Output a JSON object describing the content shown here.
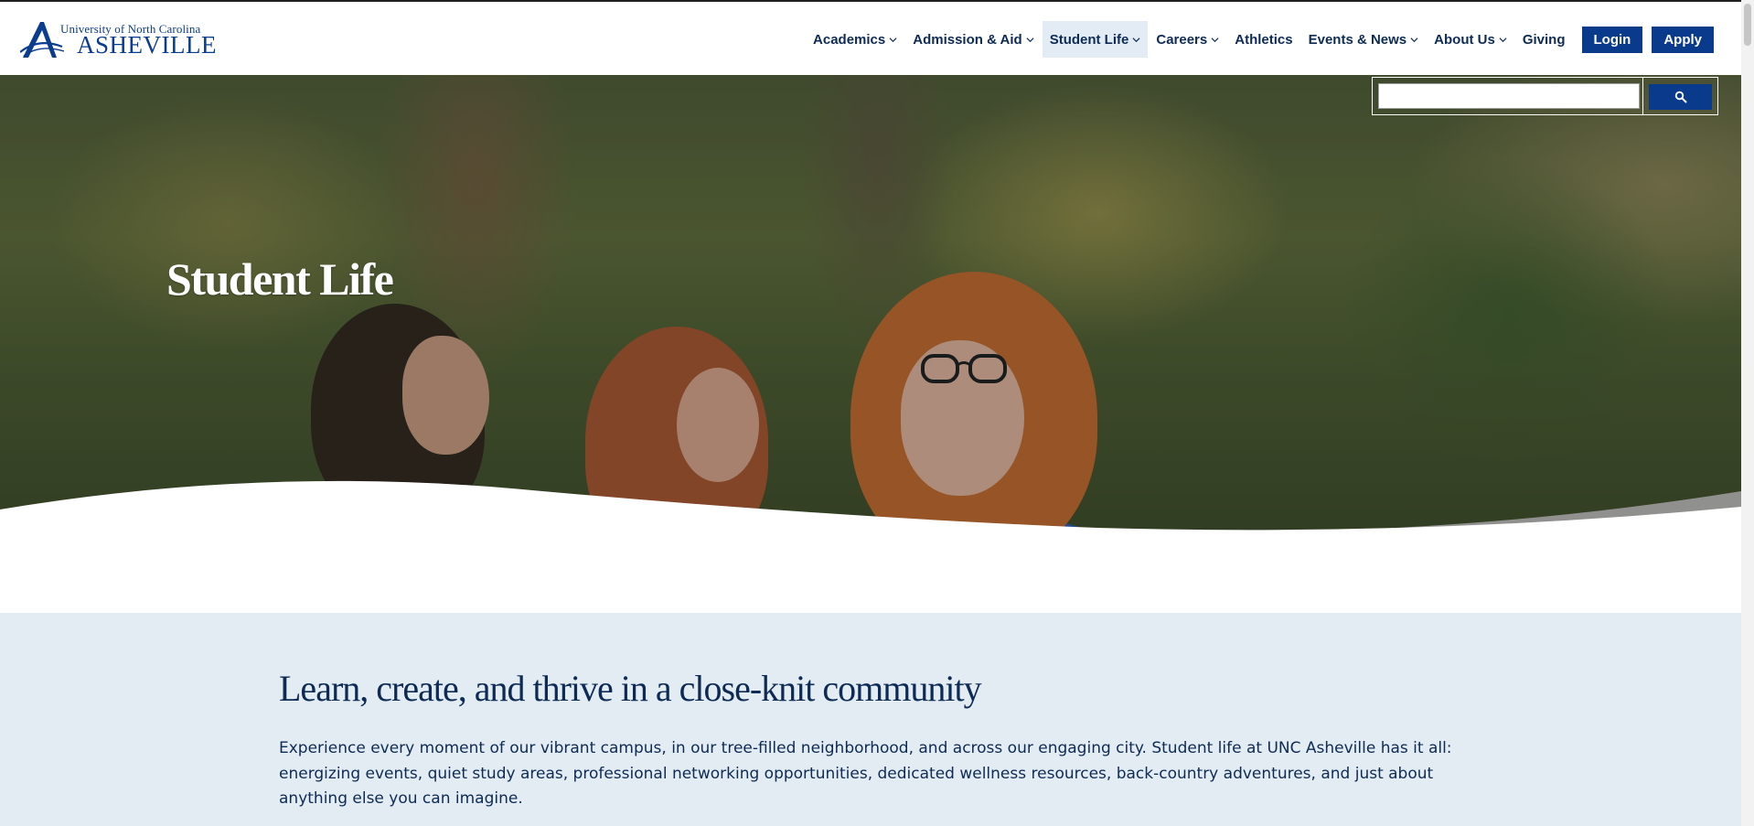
{
  "logo": {
    "line1": "University of North Carolina",
    "line2": "ASHEVILLE",
    "icon": "unca-logo-icon"
  },
  "nav": {
    "items": [
      {
        "label": "Academics",
        "has_dropdown": true
      },
      {
        "label": "Admission & Aid",
        "has_dropdown": true
      },
      {
        "label": "Student Life",
        "has_dropdown": true,
        "active": true
      },
      {
        "label": "Careers",
        "has_dropdown": true
      },
      {
        "label": "Athletics",
        "has_dropdown": false
      },
      {
        "label": "Events & News",
        "has_dropdown": true
      },
      {
        "label": "About Us",
        "has_dropdown": true
      },
      {
        "label": "Giving",
        "has_dropdown": false
      }
    ],
    "login_label": "Login",
    "apply_label": "Apply"
  },
  "search": {
    "value": "",
    "placeholder": "",
    "icon": "search-icon"
  },
  "hero": {
    "title": "Student Life"
  },
  "intro": {
    "heading": "Learn, create, and thrive in a close-knit community",
    "body": "Experience every moment of our vibrant campus, in our tree-filled neighborhood, and across our engaging city. Student life at UNC Asheville has it all: energizing events, quiet study areas, professional networking opportunities, dedicated wellness resources, back-country adventures, and just about anything else you can imagine."
  },
  "colors": {
    "brand_blue": "#0a3a8c",
    "text_navy": "#0d2b55",
    "section_bg": "#e4ecf3",
    "nav_active_bg": "#e3ecf4"
  }
}
